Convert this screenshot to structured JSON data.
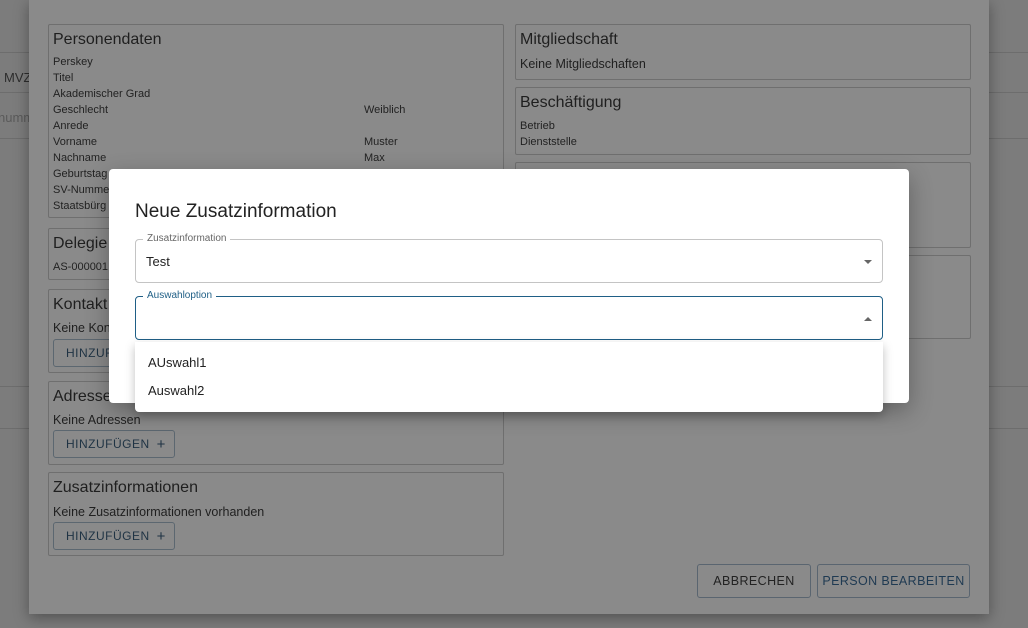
{
  "background": {
    "left_text": "MVZ",
    "left_field_hint": "numm"
  },
  "person_data": {
    "title": "Personendaten",
    "rows": [
      {
        "label": "Perskey",
        "value": ""
      },
      {
        "label": "Titel",
        "value": ""
      },
      {
        "label": "Akademischer Grad",
        "value": ""
      },
      {
        "label": "Geschlecht",
        "value": "Weiblich"
      },
      {
        "label": "Anrede",
        "value": ""
      },
      {
        "label": "Vorname",
        "value": "Muster"
      },
      {
        "label": "Nachname",
        "value": "Max"
      },
      {
        "label": "Geburtstag",
        "value": ""
      },
      {
        "label": "SV-Nummer",
        "value": ""
      },
      {
        "label": "Staatsbürg",
        "value": ""
      }
    ]
  },
  "delegation": {
    "title": "Delegie",
    "value": "AS-000001"
  },
  "contacts": {
    "title": "Kontakt",
    "empty_text": "Keine Kon",
    "add_label": "HINZUF"
  },
  "addresses": {
    "title": "Adresse",
    "empty_text": "Keine Adressen",
    "add_label": "HINZUFÜGEN"
  },
  "additional_info": {
    "title": "Zusatzinformationen",
    "empty_text": "Keine Zusatzinformationen vorhanden",
    "add_label": "HINZUFÜGEN"
  },
  "membership": {
    "title": "Mitgliedschaft",
    "empty_text": "Keine Mitgliedschaften"
  },
  "employment": {
    "title": "Beschäftigung",
    "rows": [
      "Betrieb",
      "Dienststelle"
    ]
  },
  "footer": {
    "cancel_label": "ABBRECHEN",
    "edit_label": "PERSON BEARBEITEN"
  },
  "modal": {
    "title": "Neue Zusatzinformation",
    "field1": {
      "label": "Zusatzinformation",
      "value": "Test"
    },
    "field2": {
      "label": "Auswahloption",
      "value": ""
    },
    "options": [
      "AUswahl1",
      "Auswahl2"
    ]
  },
  "colors": {
    "overlay": "#7c7c7c",
    "accent": "#1f5f86"
  },
  "icons": [
    "plus-icon",
    "chevron-down-icon",
    "chevron-up-icon"
  ]
}
